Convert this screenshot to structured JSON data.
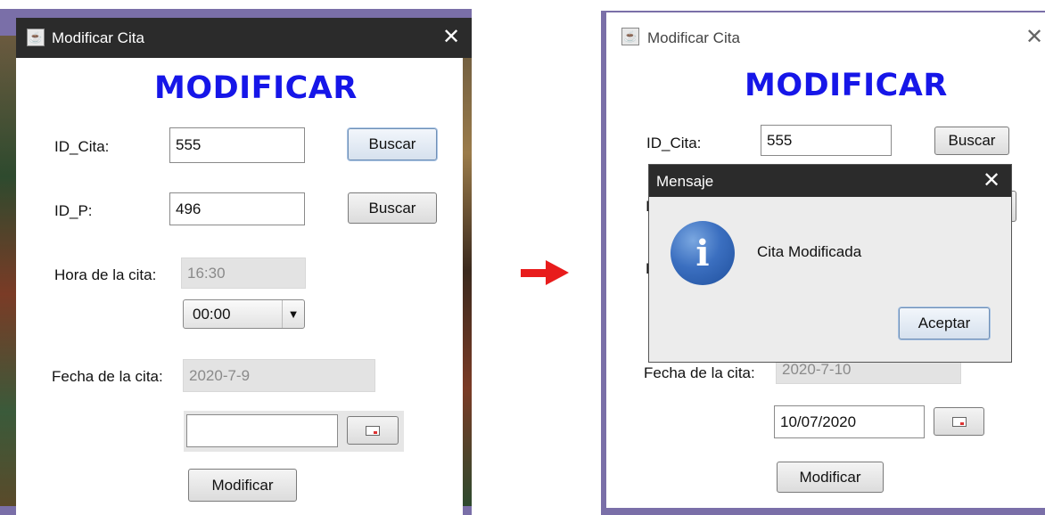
{
  "left_window": {
    "title": "Modificar Cita",
    "heading": "MODIFICAR",
    "id_cita_label": "ID_Cita:",
    "id_cita_value": "555",
    "buscar1_label": "Buscar",
    "id_p_label": "ID_P:",
    "id_p_value": "496",
    "buscar2_label": "Buscar",
    "hora_label": "Hora de la cita:",
    "hora_value": "16:30",
    "hora_select_value": "00:00",
    "fecha_label": "Fecha de la cita:",
    "fecha_value": "2020-7-9",
    "date_input_value": "",
    "modificar_label": "Modificar"
  },
  "right_window": {
    "title": "Modificar Cita",
    "heading": "MODIFICAR",
    "id_cita_label": "ID_Cita:",
    "id_cita_value": "555",
    "buscar1_label": "Buscar",
    "partial_label_1": "I",
    "partial_label_2": "H",
    "fecha_label": "Fecha de la cita:",
    "fecha_value": "2020-7-10",
    "date_input_value": "10/07/2020",
    "modificar_label": "Modificar"
  },
  "dialog": {
    "title": "Mensaje",
    "message": "Cita Modificada",
    "ok_label": "Aceptar"
  },
  "colors": {
    "heading": "#1616e8",
    "titlebar": "#2b2b2b",
    "frame": "#7a6fa8",
    "arrow": "#e81c1c"
  },
  "icons": {
    "window": "java-cup-icon",
    "close": "close-icon",
    "dropdown": "triangle-down-icon",
    "calendar": "calendar-icon",
    "info": "info-icon",
    "arrow": "arrow-right-icon"
  }
}
